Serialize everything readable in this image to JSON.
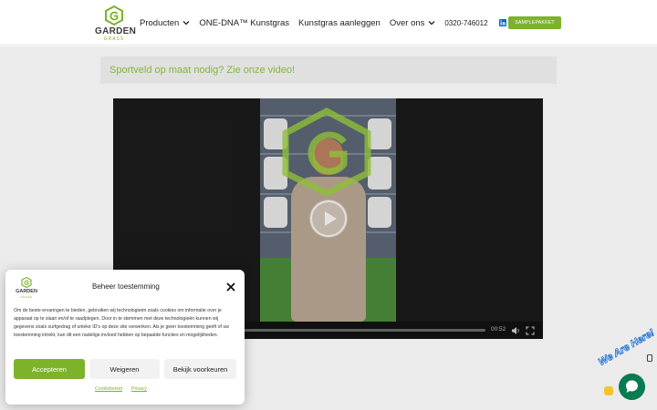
{
  "header": {
    "logo": {
      "word1": "GARDEN",
      "word2": "GRASS"
    },
    "nav": [
      {
        "label": "Producten",
        "has_dropdown": true
      },
      {
        "label": "ONE-DNA™ Kunstgras",
        "has_dropdown": false
      },
      {
        "label": "Kunstgras aanleggen",
        "has_dropdown": false
      },
      {
        "label": "Over ons",
        "has_dropdown": true
      }
    ],
    "phone": "0320-746012",
    "social": [
      "linkedin-icon",
      "instagram-icon"
    ],
    "sample_button": "SAMPLEPAKKET"
  },
  "content": {
    "promo_text": "Sportveld op maat nodig? Zie onze video!",
    "video": {
      "time": "00:52",
      "icons": [
        "play-icon",
        "volume-icon",
        "fullscreen-icon"
      ]
    }
  },
  "consent": {
    "title": "Beheer toestemming",
    "body": "Om de beste ervaringen te bieden, gebruiken wij technologieën zoals cookies om informatie over je apparaat op te slaan en/of te raadplegen. Door in te stemmen met deze technologieën kunnen wij gegevens zoals surfgedrag of unieke ID's op deze site verwerken. Als je geen toestemming geeft of uw toestemming intrekt, kan dit een nadelige invloed hebben op bepaalde functies en mogelijkheden.",
    "accept_label": "Accepteren",
    "reject_label": "Weigeren",
    "prefs_label": "Bekijk voorkeuren",
    "links": [
      "Cookiebeleid",
      "Privacy"
    ]
  },
  "chat": {
    "label": "We Are Here!"
  },
  "colors": {
    "brand_green": "#7cb32a",
    "promo_green": "#8dc63f",
    "chat_green": "#0a7a50"
  }
}
